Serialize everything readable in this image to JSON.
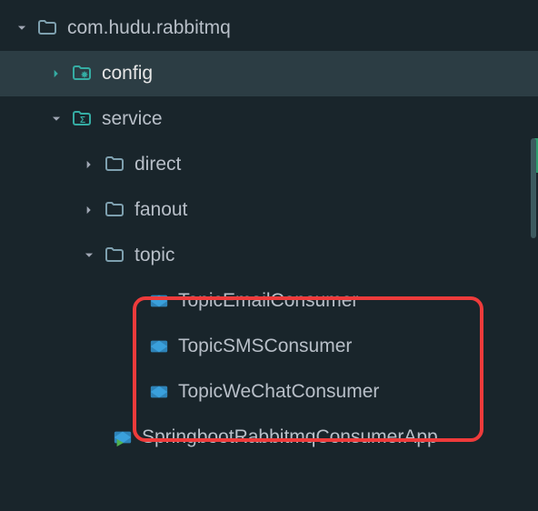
{
  "tree": {
    "root": {
      "label": "com.hudu.rabbitmq",
      "expanded": true
    },
    "config": {
      "label": "config",
      "expanded": false
    },
    "service": {
      "label": "service",
      "expanded": true
    },
    "direct": {
      "label": "direct",
      "expanded": false
    },
    "fanout": {
      "label": "fanout",
      "expanded": false
    },
    "topic": {
      "label": "topic",
      "expanded": true
    },
    "topicEmail": {
      "label": "TopicEmailConsumer"
    },
    "topicSms": {
      "label": "TopicSMSConsumer"
    },
    "topicWechat": {
      "label": "TopicWeChatConsumer"
    },
    "app": {
      "label": "SpringbootRabbitmqConsumerApp"
    }
  }
}
